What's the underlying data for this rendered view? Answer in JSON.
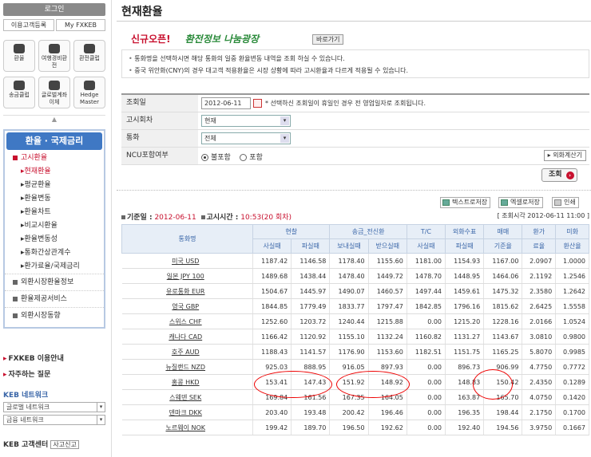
{
  "sidebar": {
    "login": "로그인",
    "register": "이용고객등록",
    "my": "My FXKEB",
    "quick": [
      {
        "label": "환율",
        "icon": "bars-icon"
      },
      {
        "label": "여행경비환전",
        "icon": "plane-icon"
      },
      {
        "label": "환전클럽",
        "icon": "club-icon"
      },
      {
        "label": "송금클럽",
        "icon": "remit-icon"
      },
      {
        "label": "글로벌계좌이체",
        "icon": "transfer-icon"
      },
      {
        "label": "Hedge Master",
        "icon": "mouse-icon"
      }
    ],
    "menu_title": "환율 · 국제금리",
    "menu": [
      {
        "label": "고시환율",
        "type": "grp-first",
        "selected": true
      },
      {
        "label": "현재환율",
        "type": "sub",
        "selected": true
      },
      {
        "label": "평균환율",
        "type": "sub"
      },
      {
        "label": "환율변동",
        "type": "sub"
      },
      {
        "label": "환율차트",
        "type": "sub"
      },
      {
        "label": "비교시환율",
        "type": "sub"
      },
      {
        "label": "환율변동성",
        "type": "sub"
      },
      {
        "label": "통화간상관계수",
        "type": "sub"
      },
      {
        "label": "환가료율/국제금리",
        "type": "sub"
      },
      {
        "label": "외환시장환율정보",
        "type": "grp"
      },
      {
        "label": "환율제공서비스",
        "type": "grp"
      },
      {
        "label": "외환시장동향",
        "type": "grp"
      }
    ],
    "guide": "FXKEB 이용안내",
    "faq": "자주하는 질문",
    "network_title": "KEB 네트워크",
    "network_sel1": "글로벌 네트워크",
    "network_sel2": "금융 네트워크",
    "cs_title": "KEB 고객센터",
    "cs_btn": "사고신고"
  },
  "main": {
    "title": "현재환율",
    "banner_new": "신규오픈!",
    "banner_plaza": "환전정보 나눔광장",
    "banner_go": "바로가기",
    "notices": [
      "통화명을 선택하시면 해당 통화의 일중 환율변동 내역을 조회 하실 수 있습니다.",
      "중국 위안화(CNY)의 경우 대고객 적용환율은 시장 상황에 따라 고시환율과 다르게 적용될 수 있습니다."
    ],
    "form": {
      "date_label": "조회일",
      "date_value": "2012-06-11",
      "date_note": "* 선택하신 조회일이 휴일인 경우 전 영업일자로 조회됩니다.",
      "round_label": "고시회차",
      "round_value": "현재",
      "currency_label": "통화",
      "currency_value": "전체",
      "ncu_label": "NCU포함여부",
      "ncu_opt1": "불포함",
      "ncu_opt2": "포함",
      "calc_btn": "외화계산기"
    },
    "query_btn": "조회",
    "text_save": "텍스트로저장",
    "excel_save": "엑셀로저장",
    "print": "인쇄",
    "base_date_label": "기준일 :",
    "base_date": "2012-06-11",
    "notice_time_label": "고시시간 :",
    "notice_time": "10:53(20 회차)",
    "query_time": "[ 조회시각 2012-06-11 11:00 ]",
    "table": {
      "headers": {
        "currency": "통화명",
        "cash": "현찰",
        "wire": "송금_전신환",
        "tc": "T/C",
        "check": "외화수표",
        "base": "매매",
        "conv": "환가",
        "usd": "미화"
      },
      "subheaders": {
        "buy": "사실때",
        "sell": "파실때",
        "send": "보내실때",
        "recv": "받으실때",
        "tc_buy": "사실때",
        "check_sell": "파실때",
        "base_rate": "기준율",
        "conv_rate": "료율",
        "usd_rate": "환산율"
      },
      "rows": [
        [
          "미국 USD",
          "1187.42",
          "1146.58",
          "1178.40",
          "1155.60",
          "1181.00",
          "1154.93",
          "1167.00",
          "2.0907",
          "1.0000"
        ],
        [
          "일본 JPY 100",
          "1489.68",
          "1438.44",
          "1478.40",
          "1449.72",
          "1478.70",
          "1448.95",
          "1464.06",
          "2.1192",
          "1.2546"
        ],
        [
          "유로통화 EUR",
          "1504.67",
          "1445.97",
          "1490.07",
          "1460.57",
          "1497.44",
          "1459.61",
          "1475.32",
          "2.3580",
          "1.2642"
        ],
        [
          "영국 GBP",
          "1844.85",
          "1779.49",
          "1833.77",
          "1797.47",
          "1842.85",
          "1796.16",
          "1815.62",
          "2.6425",
          "1.5558"
        ],
        [
          "스위스 CHF",
          "1252.60",
          "1203.72",
          "1240.44",
          "1215.88",
          "0.00",
          "1215.20",
          "1228.16",
          "2.0166",
          "1.0524"
        ],
        [
          "캐나다 CAD",
          "1166.42",
          "1120.92",
          "1155.10",
          "1132.24",
          "1160.82",
          "1131.27",
          "1143.67",
          "3.0810",
          "0.9800"
        ],
        [
          "호주 AUD",
          "1188.43",
          "1141.57",
          "1176.90",
          "1153.60",
          "1182.51",
          "1151.75",
          "1165.25",
          "5.8070",
          "0.9985"
        ],
        [
          "뉴질랜드 NZD",
          "925.03",
          "888.95",
          "916.05",
          "897.93",
          "0.00",
          "896.73",
          "906.99",
          "4.7750",
          "0.7772"
        ],
        [
          "홍콩 HKD",
          "153.41",
          "147.43",
          "151.92",
          "148.92",
          "0.00",
          "148.83",
          "150.42",
          "2.4350",
          "0.1289"
        ],
        [
          "스웨덴 SEK",
          "169.84",
          "161.56",
          "167.35",
          "164.05",
          "0.00",
          "163.87",
          "165.70",
          "4.0750",
          "0.1420"
        ],
        [
          "덴마크 DKK",
          "203.40",
          "193.48",
          "200.42",
          "196.46",
          "0.00",
          "196.35",
          "198.44",
          "2.1750",
          "0.1700"
        ],
        [
          "노르웨이 NOK",
          "199.42",
          "189.70",
          "196.50",
          "192.62",
          "0.00",
          "192.40",
          "194.56",
          "3.9750",
          "0.1667"
        ]
      ]
    }
  }
}
